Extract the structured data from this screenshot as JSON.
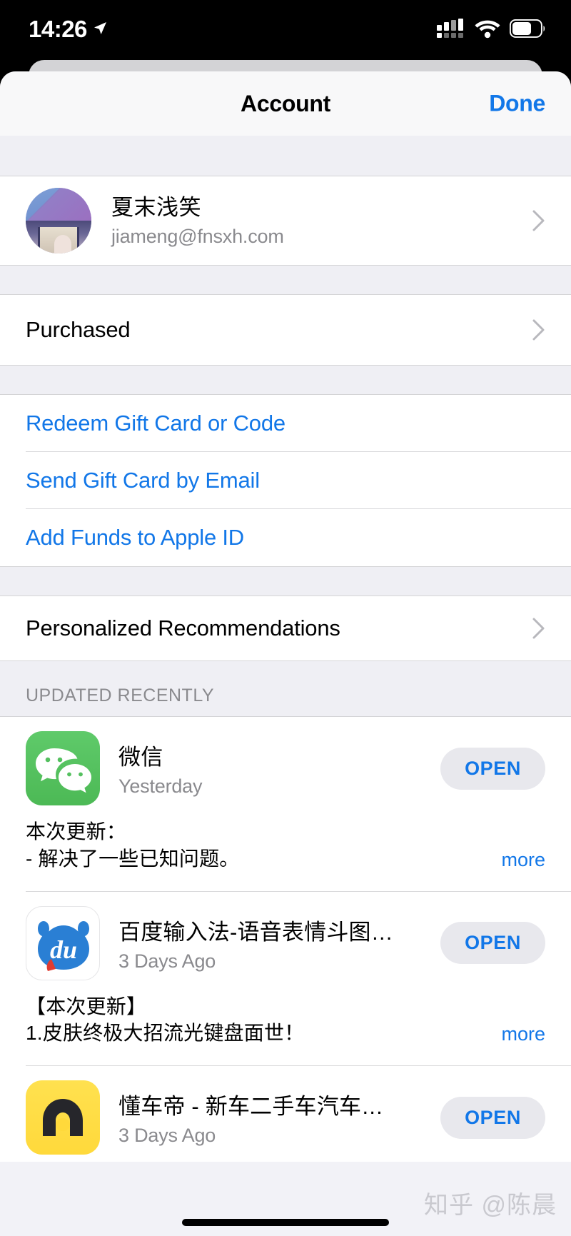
{
  "status_bar": {
    "time": "14:26",
    "location_icon": "location-arrow-icon",
    "cellular_icon": "cellular-signal-icon",
    "wifi_icon": "wifi-icon",
    "battery_icon": "battery-icon",
    "battery_level_percent": 62
  },
  "nav": {
    "title": "Account",
    "done_label": "Done"
  },
  "profile": {
    "name": "夏末浅笑",
    "email": "jiameng@fnsxh.com",
    "chevron_icon": "chevron-right-icon"
  },
  "menu": {
    "purchased": "Purchased",
    "redeem": "Redeem Gift Card or Code",
    "send_gift": "Send Gift Card by Email",
    "add_funds": "Add Funds to Apple ID",
    "personalized": "Personalized Recommendations"
  },
  "updates": {
    "section_title": "UPDATED RECENTLY",
    "more_label": "more",
    "open_label": "OPEN",
    "apps": [
      {
        "name": "微信",
        "date": "Yesterday",
        "notes_line1": "本次更新：",
        "notes_line2": "- 解决了一些已知问题。",
        "icon": "wechat-icon",
        "icon_color": "#4cb955"
      },
      {
        "name": "百度输入法-语音表情斗图…",
        "date": "3 Days Ago",
        "notes_line1": "【本次更新】",
        "notes_line2": "1.皮肤终极大招流光键盘面世！",
        "icon": "baidu-input-icon",
        "icon_color": "#2a7fd4"
      },
      {
        "name": "懂车帝 - 新车二手车汽车…",
        "date": "3 Days Ago",
        "notes_line1": "",
        "notes_line2": "",
        "icon": "dongchedi-icon",
        "icon_color": "#ffd93b"
      }
    ]
  },
  "watermark": {
    "text": "知乎 @陈晨"
  },
  "colors": {
    "accent_blue": "#1277e8",
    "group_background": "#efeff4",
    "secondary_text": "#8a8a8e"
  }
}
